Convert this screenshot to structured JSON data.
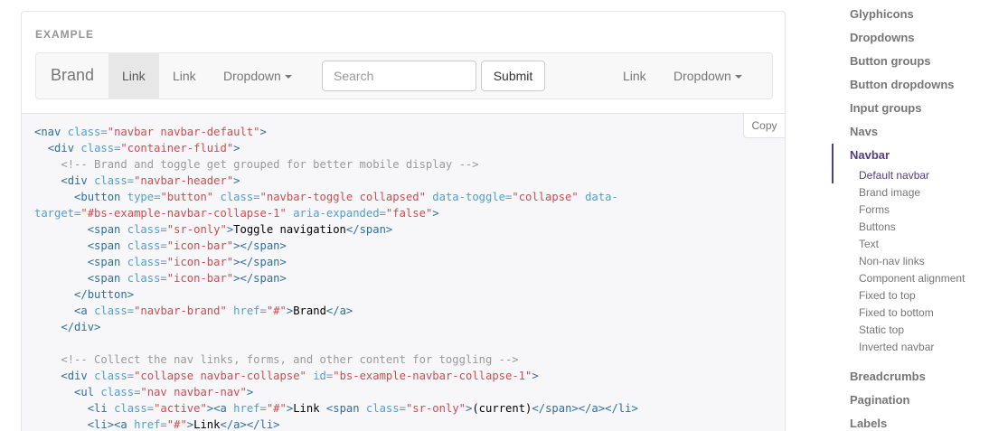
{
  "example": {
    "label": "EXAMPLE",
    "navbar": {
      "brand": "Brand",
      "link_active": "Link",
      "link": "Link",
      "dropdown": "Dropdown",
      "search_placeholder": "Search",
      "submit": "Submit",
      "right_link": "Link",
      "right_dropdown": "Dropdown"
    }
  },
  "code": {
    "copy_label": "Copy"
  },
  "sidebar": {
    "items_top": [
      "Glyphicons",
      "Dropdowns",
      "Button groups",
      "Button dropdowns",
      "Input groups",
      "Navs"
    ],
    "active_item": "Navbar",
    "sub_items": [
      "Default navbar",
      "Brand image",
      "Forms",
      "Buttons",
      "Text",
      "Non-nav links",
      "Component alignment",
      "Fixed to top",
      "Fixed to bottom",
      "Static top",
      "Inverted navbar"
    ],
    "active_sub": "Default navbar",
    "items_bottom": [
      "Breadcrumbs",
      "Pagination",
      "Labels"
    ]
  },
  "colors": {
    "accent": "#563d7c",
    "tag": "#2f6f9f",
    "attr": "#4f9fcf",
    "string": "#d44950",
    "comment": "#999999"
  }
}
